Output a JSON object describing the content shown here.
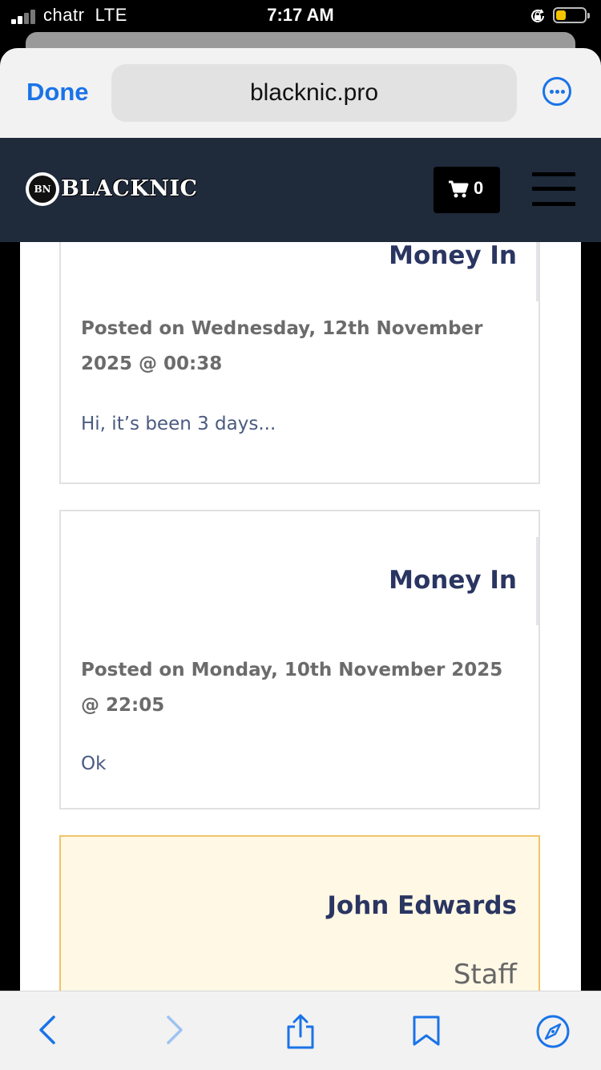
{
  "status": {
    "carrier": "chatr",
    "network": "LTE",
    "time": "7:17 AM"
  },
  "browser": {
    "done_label": "Done",
    "url": "blacknic.pro"
  },
  "site": {
    "logo_mark": "BN",
    "logo_text": "BLACKNIC",
    "cart_count": "0"
  },
  "posts": [
    {
      "title": "Money In",
      "posted": "Posted on Wednesday, 12th November 2025 @ 00:38",
      "body": "Hi, it’s been 3 days..."
    },
    {
      "title": "Money In",
      "posted": "Posted on Monday, 10th November 2025 @ 22:05",
      "body": "Ok"
    },
    {
      "title": "John Edwards",
      "role": "Staff"
    }
  ],
  "colors": {
    "link": "#1a73e8",
    "header_bg": "#1f2a3b",
    "title": "#2a3561",
    "staff_bg": "#fff8e5",
    "staff_border": "#f0c36a"
  },
  "icons": [
    "signal-icon",
    "orientation-lock-icon",
    "battery-icon",
    "more-icon",
    "logo-icon",
    "cart-icon",
    "menu-icon",
    "back-icon",
    "forward-icon",
    "share-icon",
    "bookmarks-icon",
    "compass-icon"
  ]
}
